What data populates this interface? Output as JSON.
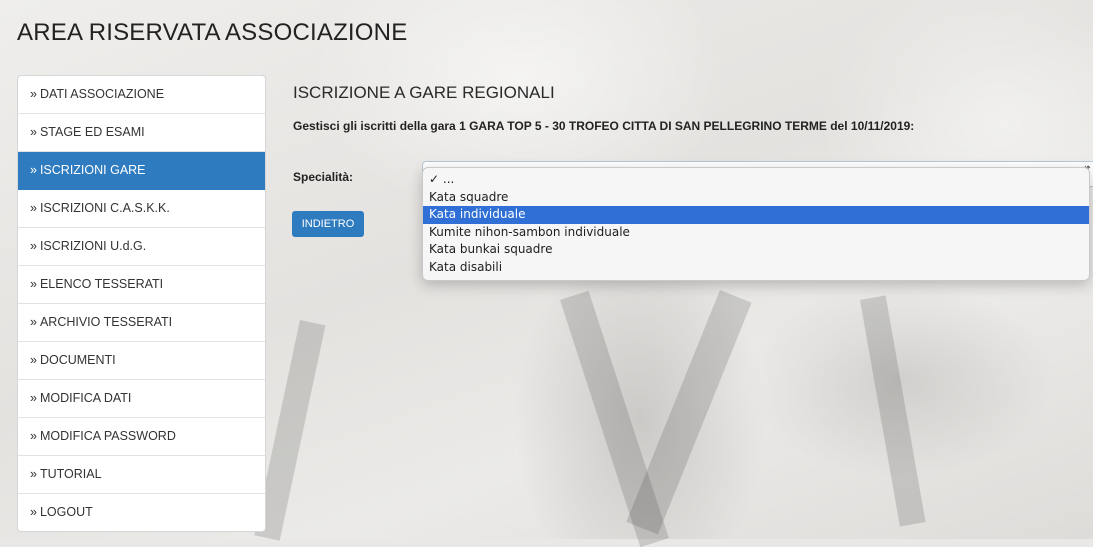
{
  "page": {
    "title": "AREA RISERVATA ASSOCIAZIONE"
  },
  "sidebar": {
    "prefix": "»",
    "items": [
      {
        "label": "DATI ASSOCIAZIONE",
        "active": false
      },
      {
        "label": "STAGE ED ESAMI",
        "active": false
      },
      {
        "label": "ISCRIZIONI GARE",
        "active": true
      },
      {
        "label": "ISCRIZIONI C.A.S.K.K.",
        "active": false
      },
      {
        "label": "ISCRIZIONI U.d.G.",
        "active": false
      },
      {
        "label": "ELENCO TESSERATI",
        "active": false
      },
      {
        "label": "ARCHIVIO TESSERATI",
        "active": false
      },
      {
        "label": "DOCUMENTI",
        "active": false
      },
      {
        "label": "MODIFICA DATI",
        "active": false
      },
      {
        "label": "MODIFICA PASSWORD",
        "active": false
      },
      {
        "label": "TUTORIAL",
        "active": false
      },
      {
        "label": "LOGOUT",
        "active": false
      }
    ]
  },
  "main": {
    "section_title": "ISCRIZIONE A GARE REGIONALI",
    "subtitle": "Gestisci gli iscritti della gara 1 GARA TOP 5 - 30 TROFEO CITTA DI SAN PELLEGRINO TERME del 10/11/2019:",
    "specialty_label": "Specialità:",
    "back_button": "INDIETRO"
  },
  "dropdown": {
    "selected_index": 0,
    "highlighted_index": 2,
    "check_mark": "✓",
    "options": [
      "...",
      "Kata squadre",
      "Kata individuale",
      "Kumite nihon-sambon individuale",
      "Kata bunkai squadre",
      "Kata disabili"
    ]
  },
  "colors": {
    "accent": "#2f7bbf",
    "highlight": "#2f6fd6"
  }
}
